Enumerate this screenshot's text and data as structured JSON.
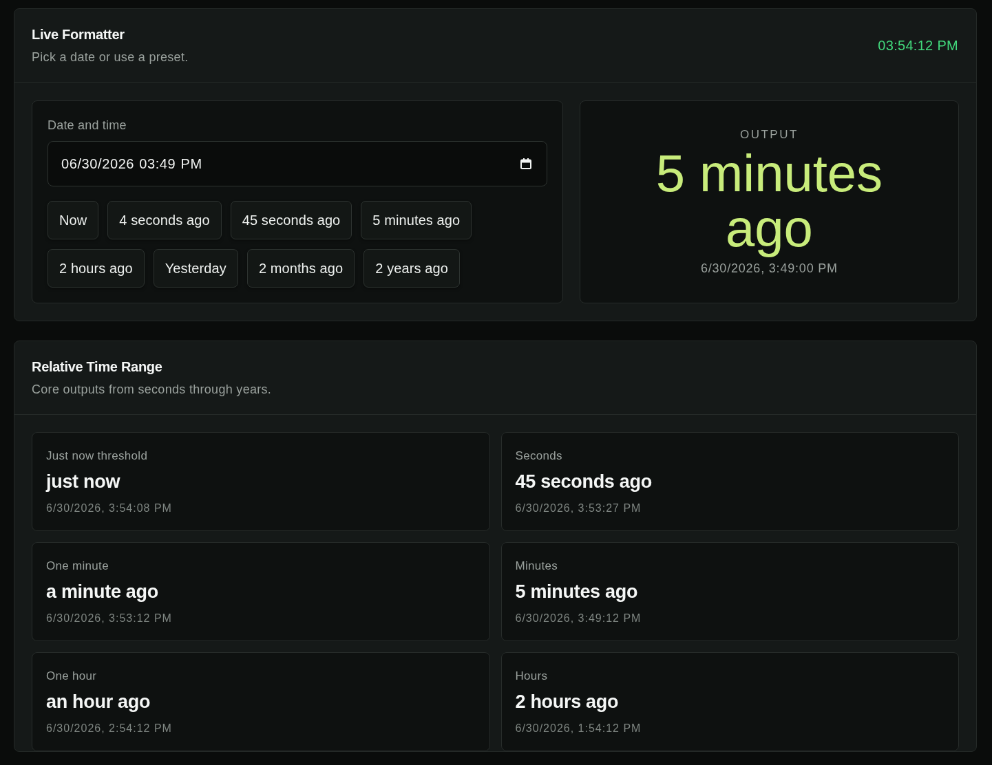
{
  "live_formatter": {
    "title": "Live Formatter",
    "subtitle": "Pick a date or use a preset.",
    "clock": "03:54:12 PM",
    "date_field": {
      "label": "Date and time",
      "value": "06/30/2026 03:49 PM"
    },
    "preset_rows": [
      [
        "Now",
        "4 seconds ago",
        "45 seconds ago",
        "5 minutes ago"
      ],
      [
        "2 hours ago",
        "Yesterday",
        "2 months ago",
        "2 years ago"
      ]
    ],
    "output": {
      "label": "OUTPUT",
      "value": "5 minutes ago",
      "timestamp": "6/30/2026, 3:49:00 PM"
    }
  },
  "relative_time_range": {
    "title": "Relative Time Range",
    "subtitle": "Core outputs from seconds through years.",
    "items": [
      {
        "label": "Just now threshold",
        "value": "just now",
        "timestamp": "6/30/2026, 3:54:08 PM"
      },
      {
        "label": "Seconds",
        "value": "45 seconds ago",
        "timestamp": "6/30/2026, 3:53:27 PM"
      },
      {
        "label": "One minute",
        "value": "a minute ago",
        "timestamp": "6/30/2026, 3:53:12 PM"
      },
      {
        "label": "Minutes",
        "value": "5 minutes ago",
        "timestamp": "6/30/2026, 3:49:12 PM"
      },
      {
        "label": "One hour",
        "value": "an hour ago",
        "timestamp": "6/30/2026, 2:54:12 PM"
      },
      {
        "label": "Hours",
        "value": "2 hours ago",
        "timestamp": "6/30/2026, 1:54:12 PM"
      }
    ]
  }
}
